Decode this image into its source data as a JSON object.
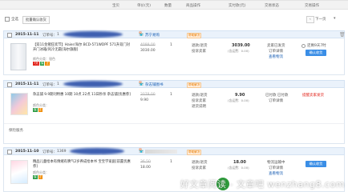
{
  "header": {
    "columns": [
      "宝贝",
      "单价(元)",
      "数量",
      "商品操作",
      "实付款(元)",
      "交易状态",
      "交易操作"
    ]
  },
  "toolbar": {
    "select_all": "全选",
    "batch_confirm": "批量确认收货",
    "next_page": "下一页",
    "prev_arrow": "‹"
  },
  "orders": [
    {
      "date": "2015-11-11",
      "order_label": "订单号：",
      "order_no_prefix": "1",
      "shop": "苏宁易购",
      "discount": "帮助解决",
      "product_title": "【双11金猪狂欢节】Haier/海尔 BCD-571WDPF 571升双门对开门冰箱/风冷无霜[海尔旗舰]",
      "product_meta": "颜色分类：银色",
      "price_old": "4099.00",
      "price": "3030.00",
      "qty": "1",
      "ops": [
        "退款/退货",
        "投诉卖家"
      ],
      "paid": "3039.00",
      "paid_note": "(含运费：0.00)",
      "status": [
        "卖家已发货",
        "订单详情",
        "查看物流"
      ],
      "actions": [
        "还剩9天7时",
        "确认收货"
      ]
    },
    {
      "date": "2015-11-11",
      "order_label": "订单号：",
      "order_no_prefix": "1",
      "shop": "杂志铺图书",
      "discount": "帮助解决",
      "product_title": "杂志铺 9.9期刊特惠 10期 10点 22点 11日秒杀 杂志铺[优惠券]",
      "product_meta": "颜色分类：",
      "price_old": "2078.00",
      "price": "9.90",
      "qty": "1",
      "ops": [
        "退款/退货",
        "投诉卖家",
        "退货说明"
      ],
      "paid": "9.90",
      "paid_note": "(含运费：0.00)",
      "status": [
        "已付款 已付款",
        "订单详情"
      ],
      "actions": [
        "提醒卖家发货"
      ],
      "extra": "保险服务"
    },
    {
      "date": "2015-11-10",
      "order_label": "订单号：",
      "order_no_prefix": "1369",
      "shop": "",
      "discount": "帮助解决",
      "product_title": "精品儿童绘本有情绪有脾气2岁养成绘本书 宝宝学家庭[前置优惠券]",
      "product_meta": "颜色分类：",
      "price_old": "36.50",
      "price": "18.00",
      "qty": "1",
      "ops": [
        "退款/退货",
        "投诉卖家"
      ],
      "paid": "18.00",
      "paid_note": "(含运费：0.00)",
      "status": [
        "物流运输中",
        "订单详情",
        "查看物流"
      ],
      "actions": [
        "确认收货"
      ]
    }
  ],
  "watermark": {
    "text": "好文章阅读 - 文章吧 wenzhang8.com"
  },
  "colors": {
    "accent_blue": "#3a8ee6",
    "price_red": "#e2231a",
    "link_blue": "#1a5fb4",
    "order_head_bg": "#eaf2fb"
  }
}
